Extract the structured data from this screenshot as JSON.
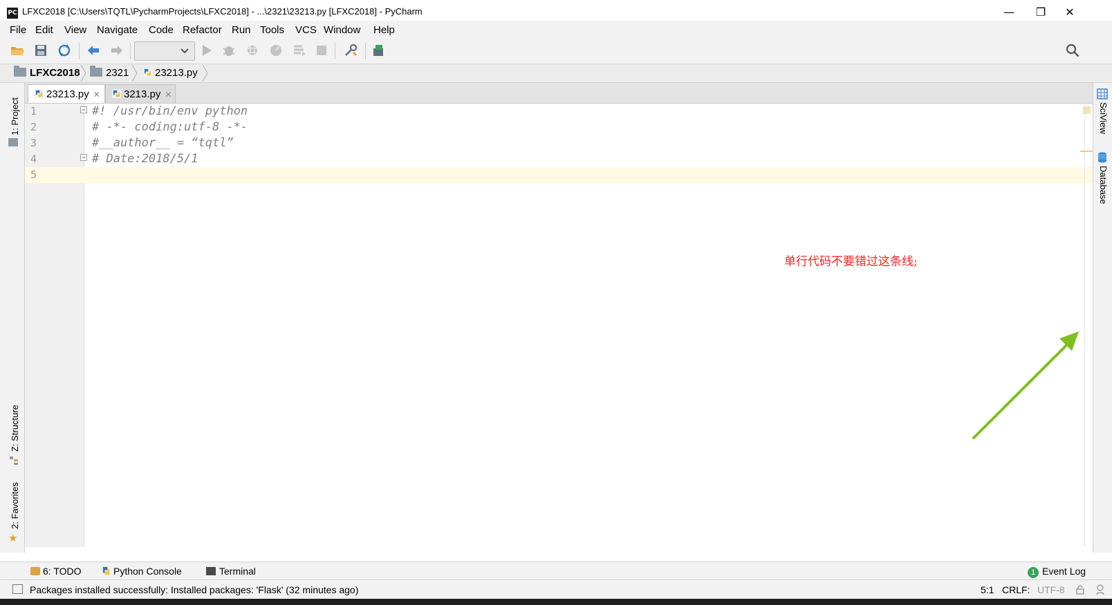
{
  "window": {
    "app_icon": "PC",
    "title": "LFXC2018 [C:\\Users\\TQTL\\PycharmProjects\\LFXC2018] - ...\\2321\\23213.py [LFXC2018] - PyCharm",
    "minimize": "—",
    "restore": "❐",
    "close": "✕"
  },
  "menu": [
    "File",
    "Edit",
    "View",
    "Navigate",
    "Code",
    "Refactor",
    "Run",
    "Tools",
    "VCS",
    "Window",
    "Help"
  ],
  "toolbar": {
    "icons": [
      "open-folder-icon",
      "save-icon",
      "sync-icon",
      "back-icon",
      "forward-icon",
      "run-icon",
      "debug-icon",
      "coverage-icon",
      "profile-icon",
      "concurrency-icon",
      "stop-icon",
      "settings-icon",
      "sdk-icon",
      "search-icon"
    ],
    "run_config_value": ""
  },
  "breadcrumb": [
    "LFXC2018",
    "2321",
    "23213.py"
  ],
  "tabs": [
    {
      "label": "23213.py",
      "active": true
    },
    {
      "label": "3213.py",
      "active": false
    }
  ],
  "left_tool_tabs": [
    "1: Project",
    "Z: Structure",
    "2: Favorites"
  ],
  "right_tool_tabs": [
    "SciView",
    "Database"
  ],
  "editor": {
    "line_numbers": [
      "1",
      "2",
      "3",
      "4",
      "5"
    ],
    "lines": [
      "#! /usr/bin/env python",
      "# -*- coding:utf-8 -*-",
      "#__author__ = “tqtl”",
      "# Date:2018/5/1",
      ""
    ],
    "annotation_text": "单行代码不要错过这条线;",
    "annotation_color": "#ff2020",
    "arrow_color": "#7fbf1f"
  },
  "bottom_tools": {
    "todo": "6: TODO",
    "python_console": "Python Console",
    "terminal": "Terminal",
    "event_log_count": "1",
    "event_log": "Event Log"
  },
  "status": {
    "message": "Packages installed successfully: Installed packages: 'Flask' (32 minutes ago)",
    "position": "5:1",
    "line_sep": "CRLF:",
    "encoding": "UTF-8"
  },
  "colors": {
    "caret_line": "#fffae3",
    "comment": "#808080",
    "chrome": "#f2f2f2"
  }
}
